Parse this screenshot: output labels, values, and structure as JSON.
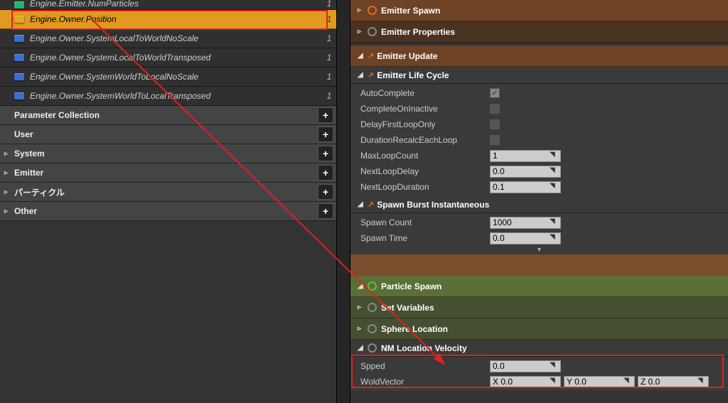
{
  "left": {
    "cutoff": {
      "label": "Engine.Emitter.NumParticles",
      "count": "1"
    },
    "params": [
      {
        "pin": "yellow",
        "label": "Engine.Owner.Position",
        "count": "1",
        "selected": true
      },
      {
        "pin": "blue",
        "label": "Engine.Owner.SystemLocalToWorldNoScale",
        "count": "1"
      },
      {
        "pin": "blue",
        "label": "Engine.Owner.SystemLocalToWorldTransposed",
        "count": "1"
      },
      {
        "pin": "blue",
        "label": "Engine.Owner.SystemWorldToLocalNoScale",
        "count": "1"
      },
      {
        "pin": "blue",
        "label": "Engine.Owner.SystemWorldToLocalTransposed",
        "count": "1"
      }
    ],
    "sections": [
      {
        "label": "Parameter Collection",
        "caret": ""
      },
      {
        "label": "User",
        "caret": ""
      },
      {
        "label": "System",
        "caret": "▹"
      },
      {
        "label": "Emitter",
        "caret": "▹"
      },
      {
        "label": "パーティクル",
        "caret": "▹"
      },
      {
        "label": "Other",
        "caret": "▹"
      }
    ]
  },
  "right": {
    "emitterSpawn": "Emitter Spawn",
    "emitterProps": "Emitter Properties",
    "emitterUpdate": "Emitter Update",
    "lifeCycle": {
      "title": "Emitter Life Cycle",
      "rows": [
        {
          "label": "AutoComplete",
          "kind": "check",
          "checked": true
        },
        {
          "label": "CompleteOnInactive",
          "kind": "check",
          "checked": false
        },
        {
          "label": "DelayFirstLoopOnly",
          "kind": "check",
          "checked": false
        },
        {
          "label": "DurationRecalcEachLoop",
          "kind": "check",
          "checked": false
        },
        {
          "label": "MaxLoopCount",
          "kind": "num",
          "value": "1"
        },
        {
          "label": "NextLoopDelay",
          "kind": "num",
          "value": "0.0"
        },
        {
          "label": "NextLoopDuration",
          "kind": "num",
          "value": "0.1"
        }
      ]
    },
    "spawnBurst": {
      "title": "Spawn Burst Instantaneous",
      "rows": [
        {
          "label": "Spawn Count",
          "kind": "num",
          "value": "1000"
        },
        {
          "label": "Spawn Time",
          "kind": "num",
          "value": "0.0"
        }
      ]
    },
    "particleSpawn": "Particle Spawn",
    "setVariables": "Set Variables",
    "sphereLocation": "Sphere Location",
    "nmLocVel": {
      "title": "NM Location Velocity",
      "speed": {
        "label": "Spped",
        "value": "0.0"
      },
      "vec": {
        "label": "WoldVector",
        "x": "X 0.0",
        "y": "Y 0.0",
        "z": "Z 0.0"
      }
    }
  }
}
